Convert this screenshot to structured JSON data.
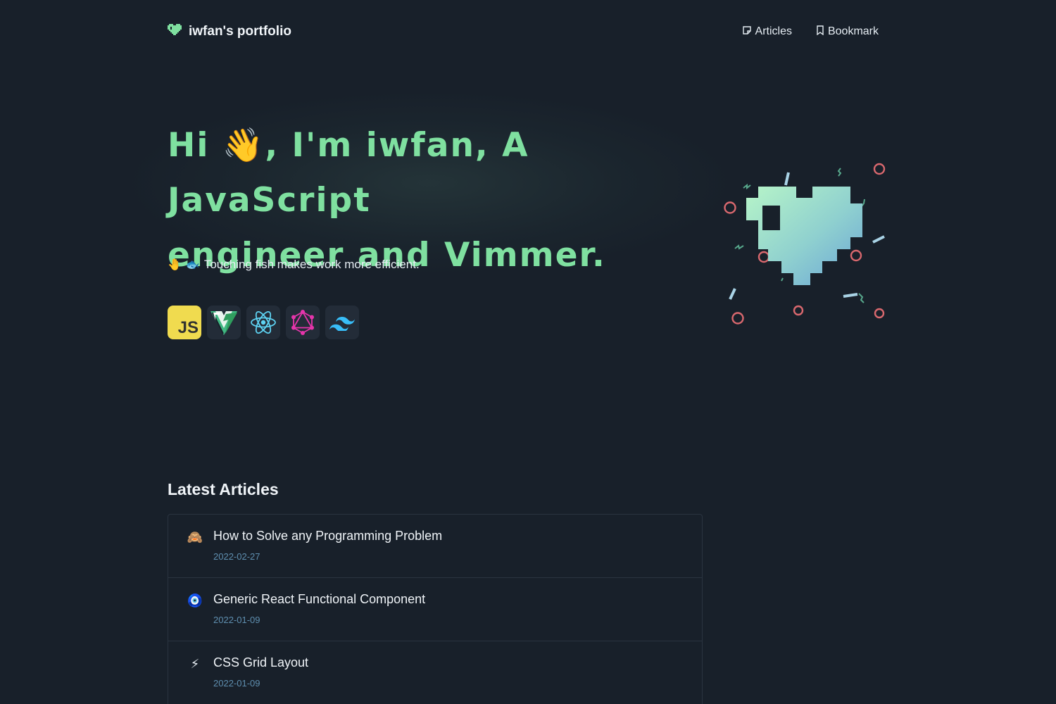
{
  "header": {
    "brand_title": "iwfan's portfolio",
    "brand_icon": "heart-icon",
    "nav": [
      {
        "label": "Articles",
        "icon": "note-icon"
      },
      {
        "label": "Bookmark",
        "icon": "bookmark-icon"
      }
    ]
  },
  "hero": {
    "title_line1": "Hi 👋, I'm iwfan, A JavaScript",
    "title_line2": "engineer and Vimmer.",
    "tagline_emoji_1": "🤚",
    "tagline_emoji_2": "🐟",
    "tagline": "Touching fish makes work more efficient.",
    "stack": [
      {
        "name": "javascript-icon",
        "label": "JS"
      },
      {
        "name": "vite-icon"
      },
      {
        "name": "react-icon"
      },
      {
        "name": "graphql-icon"
      },
      {
        "name": "tailwind-icon"
      }
    ]
  },
  "articles": {
    "heading": "Latest Articles",
    "items": [
      {
        "emoji": "🙈",
        "title": "How to Solve any Programming Problem",
        "date": "2022-02-27"
      },
      {
        "emoji": "🧿",
        "title": "Generic React Functional Component",
        "date": "2022-01-09"
      },
      {
        "emoji": "⚡",
        "title": "CSS Grid Layout",
        "date": "2022-01-09"
      }
    ]
  },
  "colors": {
    "background": "#18202a",
    "accent": "#7fe0a0",
    "date": "#5f8fb0",
    "border": "#2a3440"
  }
}
